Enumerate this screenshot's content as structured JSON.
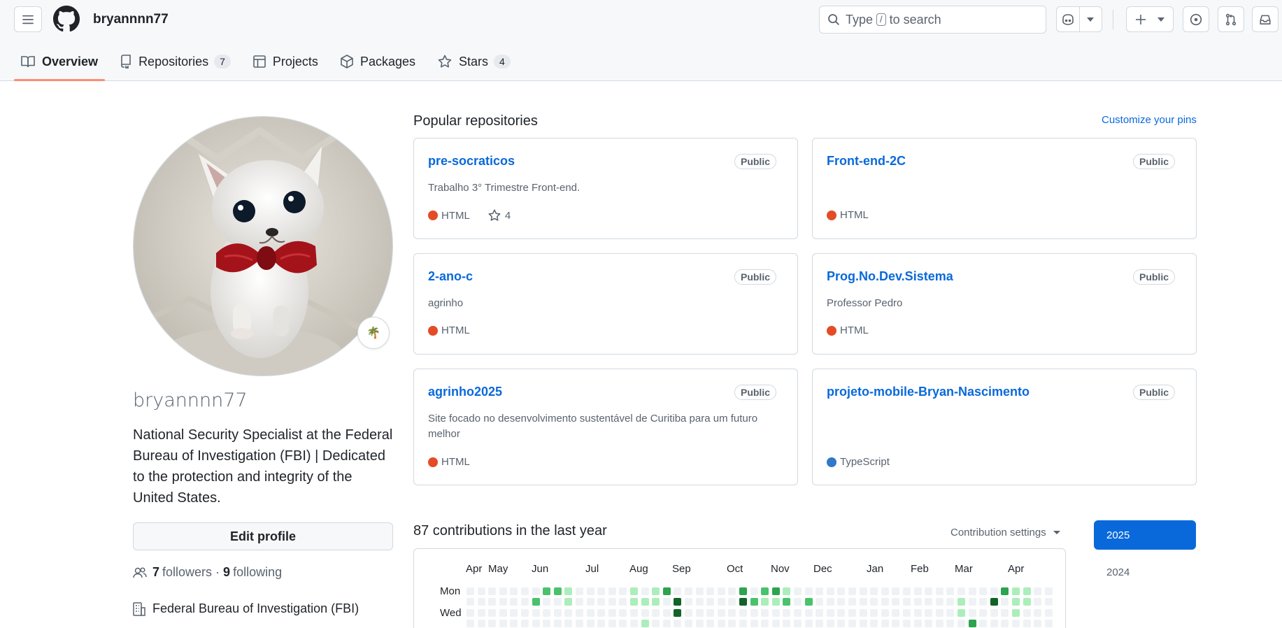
{
  "header": {
    "username": "bryannnn77",
    "search": {
      "prefix": "Type",
      "key": "/",
      "suffix": "to search"
    }
  },
  "tabs": [
    {
      "label": "Overview",
      "icon": "book-icon",
      "active": true
    },
    {
      "label": "Repositories",
      "icon": "repo-icon",
      "count": "7"
    },
    {
      "label": "Projects",
      "icon": "table-icon"
    },
    {
      "label": "Packages",
      "icon": "package-icon"
    },
    {
      "label": "Stars",
      "icon": "star-icon",
      "count": "4"
    }
  ],
  "profile": {
    "login": "bryannnn77",
    "status_emoji": "🌴",
    "bio": "National Security Specialist at the Federal Bureau of Investigation (FBI) | Dedicated to the protection and integrity of the United States.",
    "edit_label": "Edit profile",
    "followers_count": "7",
    "followers_label": "followers",
    "separator": "·",
    "following_count": "9",
    "following_label": "following",
    "organization": "Federal Bureau of Investigation (FBI)"
  },
  "pinned": {
    "title": "Popular repositories",
    "customize_label": "Customize your pins",
    "repos": [
      {
        "name": "pre-socraticos",
        "visibility": "Public",
        "description": "Trabalho 3° Trimestre Front-end.",
        "language": "HTML",
        "language_color": "#e34c26",
        "stars": "4"
      },
      {
        "name": "Front-end-2C",
        "visibility": "Public",
        "description": "",
        "language": "HTML",
        "language_color": "#e34c26"
      },
      {
        "name": "2-ano-c",
        "visibility": "Public",
        "description": "agrinho",
        "language": "HTML",
        "language_color": "#e34c26"
      },
      {
        "name": "Prog.No.Dev.Sistema",
        "visibility": "Public",
        "description": "Professor Pedro",
        "language": "HTML",
        "language_color": "#e34c26"
      },
      {
        "name": "agrinho2025",
        "visibility": "Public",
        "description": "Site focado no desenvolvimento sustentável de Curitiba para um futuro melhor",
        "language": "HTML",
        "language_color": "#e34c26"
      },
      {
        "name": "projeto-mobile-Bryan-Nascimento",
        "visibility": "Public",
        "description": "",
        "language": "TypeScript",
        "language_color": "#3178c6"
      }
    ]
  },
  "contributions": {
    "title": "87 contributions in the last year",
    "settings_label": "Contribution settings",
    "months": [
      "Apr",
      "May",
      "Jun",
      "Jul",
      "Aug",
      "Sep",
      "Oct",
      "Nov",
      "Dec",
      "Jan",
      "Feb",
      "Mar",
      "Apr"
    ],
    "day_labels": [
      "Mon",
      "Wed"
    ],
    "years": [
      "2025",
      "2024"
    ],
    "selected_year": "2025",
    "level_colors": [
      "#eff2f5",
      "#aceebb",
      "#4ac26b",
      "#2da44e",
      "#116329"
    ],
    "levels": {
      "mon": [
        0,
        0,
        0,
        0,
        0,
        0,
        0,
        2,
        2,
        1,
        0,
        0,
        0,
        0,
        0,
        1,
        0,
        1,
        3,
        0,
        0,
        0,
        0,
        0,
        0,
        3,
        0,
        2,
        3,
        1,
        0,
        0,
        0,
        0,
        0,
        0,
        0,
        0,
        0,
        0,
        0,
        0,
        0,
        0,
        0,
        0,
        0,
        0,
        0,
        3,
        1,
        1,
        0,
        0
      ],
      "tue": [
        0,
        0,
        0,
        0,
        0,
        0,
        2,
        0,
        0,
        1,
        0,
        0,
        0,
        0,
        0,
        1,
        1,
        1,
        0,
        4,
        0,
        0,
        0,
        0,
        0,
        4,
        2,
        1,
        1,
        2,
        0,
        2,
        0,
        0,
        0,
        0,
        0,
        0,
        0,
        0,
        0,
        0,
        0,
        0,
        0,
        1,
        0,
        0,
        4,
        0,
        1,
        1,
        0,
        0
      ],
      "wed": [
        0,
        0,
        0,
        0,
        0,
        0,
        0,
        0,
        0,
        0,
        0,
        0,
        0,
        0,
        0,
        0,
        0,
        0,
        0,
        4,
        0,
        0,
        0,
        0,
        0,
        0,
        0,
        0,
        0,
        0,
        0,
        0,
        0,
        0,
        0,
        0,
        0,
        0,
        0,
        0,
        0,
        0,
        0,
        0,
        0,
        1,
        0,
        0,
        0,
        0,
        1,
        0,
        0,
        0
      ],
      "thu": [
        0,
        0,
        0,
        0,
        0,
        0,
        0,
        0,
        0,
        0,
        0,
        0,
        0,
        0,
        0,
        0,
        1,
        0,
        0,
        0,
        0,
        0,
        0,
        0,
        0,
        0,
        0,
        0,
        0,
        0,
        0,
        0,
        0,
        0,
        0,
        0,
        0,
        0,
        0,
        0,
        0,
        0,
        0,
        0,
        0,
        0,
        3,
        0,
        0,
        0,
        0,
        0,
        0,
        0
      ]
    }
  }
}
